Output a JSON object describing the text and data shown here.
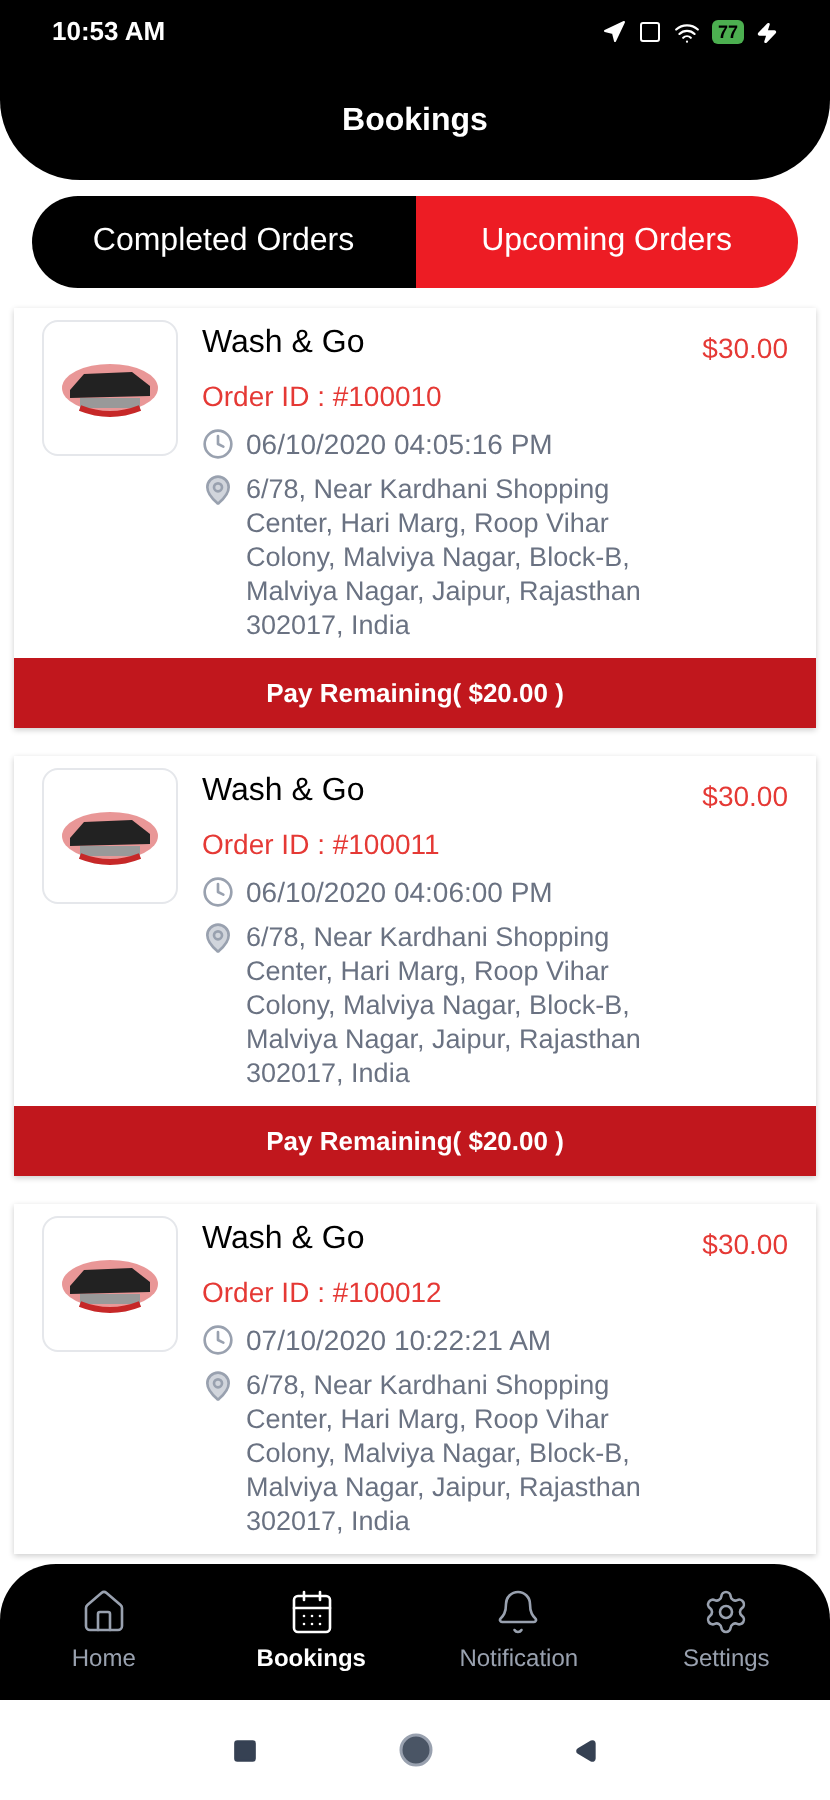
{
  "status_bar": {
    "time": "10:53 AM",
    "battery": "77"
  },
  "header": {
    "title": "Bookings"
  },
  "tabs": [
    {
      "label": "Completed Orders",
      "selected": false
    },
    {
      "label": "Upcoming Orders",
      "selected": true
    }
  ],
  "orders": [
    {
      "name": "Wash & Go",
      "price": "$30.00",
      "order_id": "Order ID : #100010",
      "datetime": "06/10/2020 04:05:16 PM",
      "address": "6/78, Near Kardhani Shopping Center, Hari Marg, Roop Vihar Colony, Malviya Nagar, Block-B, Malviya Nagar, Jaipur, Rajasthan 302017, India",
      "pay_button": "Pay Remaining( $20.00 )"
    },
    {
      "name": "Wash & Go",
      "price": "$30.00",
      "order_id": "Order ID : #100011",
      "datetime": "06/10/2020 04:06:00 PM",
      "address": "6/78, Near Kardhani Shopping Center, Hari Marg, Roop Vihar Colony, Malviya Nagar, Block-B, Malviya Nagar, Jaipur, Rajasthan 302017, India",
      "pay_button": "Pay Remaining( $20.00 )"
    },
    {
      "name": "Wash & Go",
      "price": "$30.00",
      "order_id": "Order ID : #100012",
      "datetime": "07/10/2020 10:22:21 AM",
      "address": "6/78, Near Kardhani Shopping Center, Hari Marg, Roop Vihar Colony, Malviya Nagar, Block-B, Malviya Nagar, Jaipur, Rajasthan 302017, India"
    }
  ],
  "bottom_nav": [
    {
      "label": "Home",
      "kind": "home",
      "selected": false
    },
    {
      "label": "Bookings",
      "kind": "calendar",
      "selected": true
    },
    {
      "label": "Notification",
      "kind": "bell",
      "selected": false
    },
    {
      "label": "Settings",
      "kind": "settings",
      "selected": false
    }
  ]
}
